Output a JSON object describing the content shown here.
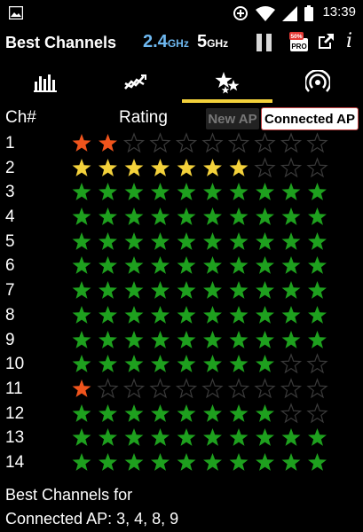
{
  "status_bar": {
    "time": "13:39",
    "icons": [
      "gallery-icon",
      "data-saver-icon",
      "wifi-icon",
      "signal-icon",
      "battery-icon"
    ]
  },
  "app_bar": {
    "title": "Best Channels",
    "band_24": {
      "number": "2.4",
      "unit": "GHz"
    },
    "band_5": {
      "number": "5",
      "unit": "GHz"
    },
    "pro_badge": "PRO",
    "pro_discount": "50%",
    "info_label": "i"
  },
  "tabs": [
    {
      "name": "channel-graph",
      "icon": "bar-chart-icon",
      "active": false
    },
    {
      "name": "time-graph",
      "icon": "trend-graph-icon",
      "active": false
    },
    {
      "name": "channel-rating",
      "icon": "stars-icon",
      "active": true
    },
    {
      "name": "ap-list",
      "icon": "wifi-signal-icon",
      "active": false
    }
  ],
  "table_header": {
    "channel": "Ch#",
    "rating": "Rating",
    "new_ap": "New AP",
    "connected_ap": "Connected AP"
  },
  "colors": {
    "green": "#1ea01e",
    "yellow": "#f3d13b",
    "red": "#f0541c",
    "empty_outline": "#3a3a3a",
    "accent_tab": "#f3d13b",
    "band_24": "#6eb8f0"
  },
  "max_stars": 10,
  "channels": [
    {
      "ch": "1",
      "rating": 2,
      "color": "red"
    },
    {
      "ch": "2",
      "rating": 7,
      "color": "yellow"
    },
    {
      "ch": "3",
      "rating": 10,
      "color": "green"
    },
    {
      "ch": "4",
      "rating": 10,
      "color": "green"
    },
    {
      "ch": "5",
      "rating": 10,
      "color": "green"
    },
    {
      "ch": "6",
      "rating": 10,
      "color": "green"
    },
    {
      "ch": "7",
      "rating": 10,
      "color": "green"
    },
    {
      "ch": "8",
      "rating": 10,
      "color": "green"
    },
    {
      "ch": "9",
      "rating": 10,
      "color": "green"
    },
    {
      "ch": "10",
      "rating": 8,
      "color": "green"
    },
    {
      "ch": "11",
      "rating": 1,
      "color": "red"
    },
    {
      "ch": "12",
      "rating": 8,
      "color": "green"
    },
    {
      "ch": "13",
      "rating": 10,
      "color": "green"
    },
    {
      "ch": "14",
      "rating": 10,
      "color": "green"
    }
  ],
  "footer": {
    "line1": "Best Channels for",
    "line2": "Connected AP: 3, 4, 8, 9"
  }
}
